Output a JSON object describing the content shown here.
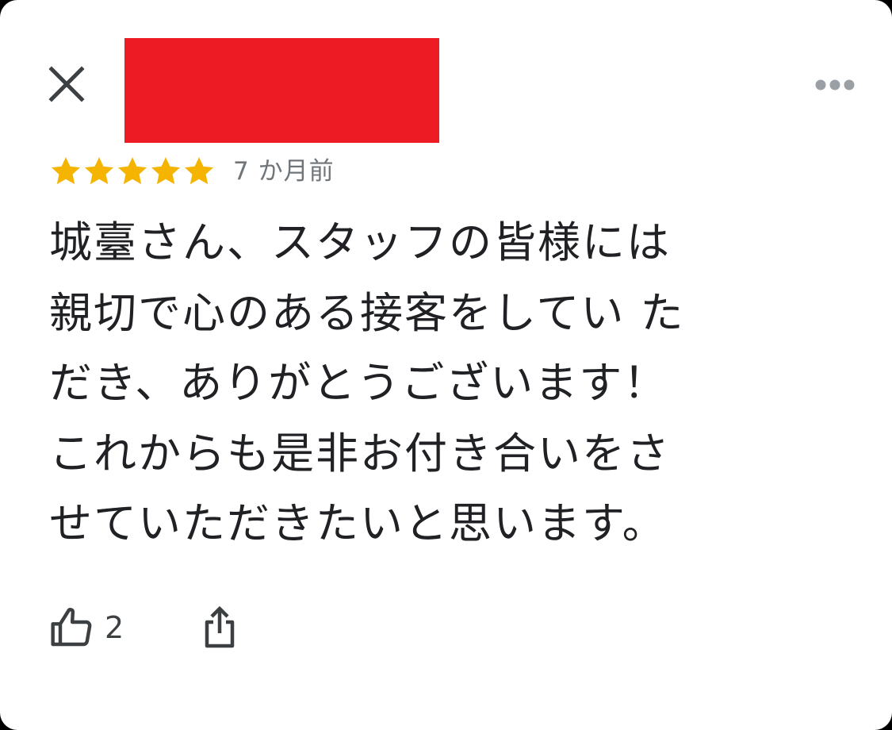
{
  "header": {
    "close_icon": "close-icon",
    "more_icon": "more-horizontal-icon",
    "name_redaction_color": "#ed1c24"
  },
  "review": {
    "rating": 5,
    "max_rating": 5,
    "star_color": "#f4b400",
    "timestamp": "7 か月前",
    "text_lines": [
      "城臺さん、スタッフの皆様には",
      "親切で心のある接客をしてい た",
      "だき、ありがとうございます！",
      "これからも是非お付き合いをさ",
      "せていただきたいと思います。"
    ]
  },
  "actions": {
    "like_icon": "thumbs-up-icon",
    "like_count": "2",
    "share_icon": "share-icon"
  }
}
